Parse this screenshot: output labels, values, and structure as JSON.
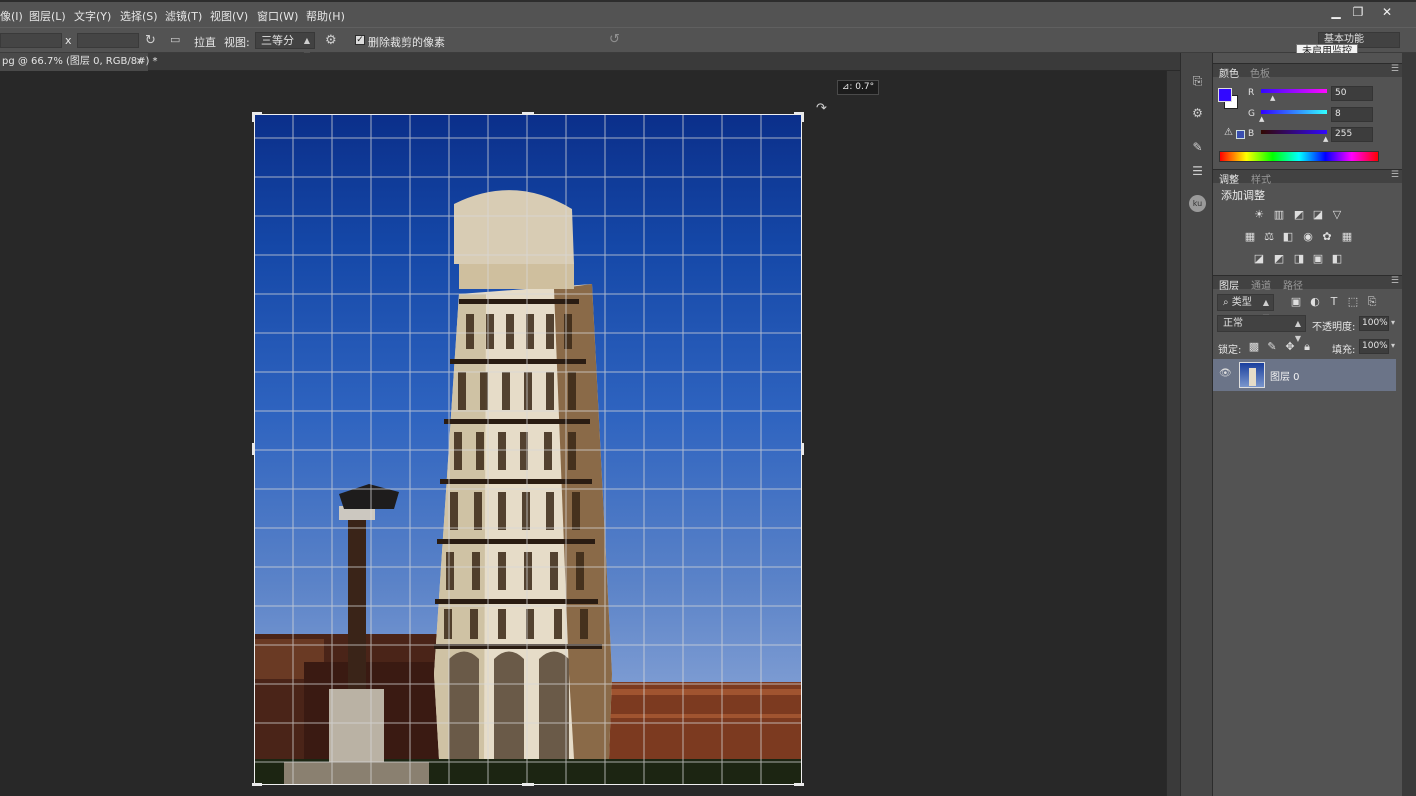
{
  "menu": {
    "items": [
      {
        "label": "像(I)"
      },
      {
        "label": "图层(L)"
      },
      {
        "label": "文字(Y)"
      },
      {
        "label": "选择(S)"
      },
      {
        "label": "滤镜(T)"
      },
      {
        "label": "视图(V)"
      },
      {
        "label": "窗口(W)"
      },
      {
        "label": "帮助(H)"
      }
    ]
  },
  "options": {
    "ratio_separator": "x",
    "straighten_label": "拉直",
    "view_label": "视图:",
    "view_value": "三等分",
    "delete_pixels_label": "删除裁剪的像素",
    "workspace_value": "基本功能",
    "tooltip": "未启用监控"
  },
  "document": {
    "tab_title": "pg @ 66.7% (图层 0, RGB/8#) *",
    "tab_close": "×",
    "tilt_readout": "⊿: 0.7°"
  },
  "color_panel": {
    "tabs": [
      "颜色",
      "色板"
    ],
    "channels": [
      {
        "label": "R",
        "value": "50"
      },
      {
        "label": "G",
        "value": "8"
      },
      {
        "label": "B",
        "value": "255"
      }
    ],
    "foreground": "#3208ff"
  },
  "adjustments_panel": {
    "tabs": [
      "调整",
      "样式"
    ],
    "heading": "添加调整"
  },
  "layers_panel": {
    "tabs": [
      "图层",
      "通道",
      "路径"
    ],
    "filter_value": "类型",
    "blend_mode": "正常",
    "opacity_label": "不透明度:",
    "opacity_value": "100%",
    "lock_label": "锁定:",
    "fill_label": "填充:",
    "fill_value": "100%",
    "layers": [
      {
        "name": "图层 0"
      }
    ]
  }
}
